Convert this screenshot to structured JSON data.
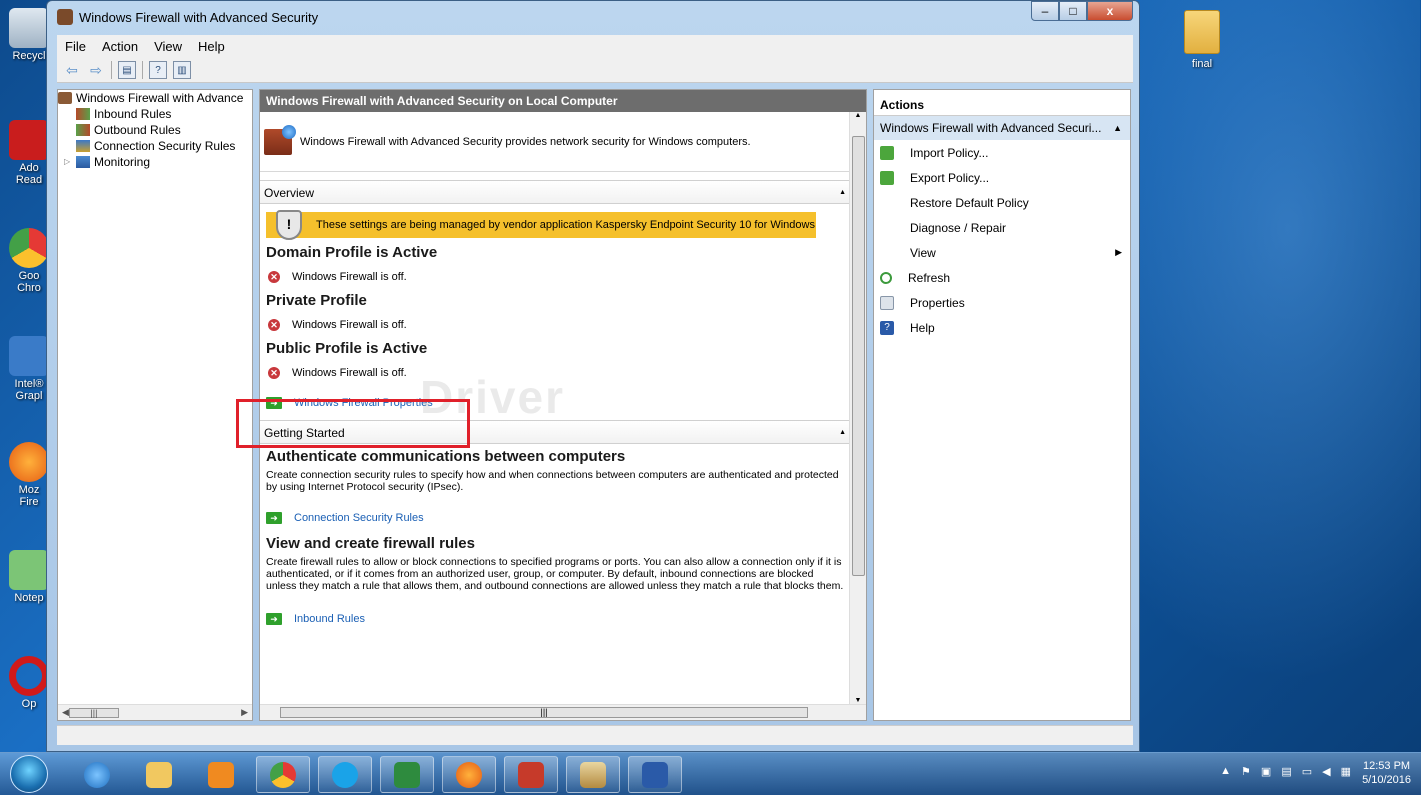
{
  "window": {
    "title": "Windows Firewall with Advanced Security",
    "controls": {
      "minimize": "–",
      "maximize": "□",
      "close": "x"
    }
  },
  "menubar": [
    "File",
    "Action",
    "View",
    "Help"
  ],
  "tree": {
    "root": "Windows Firewall with Advance",
    "items": [
      "Inbound Rules",
      "Outbound Rules",
      "Connection Security Rules",
      "Monitoring"
    ]
  },
  "center": {
    "header": "Windows Firewall with Advanced Security on Local Computer",
    "description": "Windows Firewall with Advanced Security provides network security for Windows computers.",
    "overview_label": "Overview",
    "banner": "These settings are being managed by vendor application Kaspersky Endpoint Security 10 for Windows",
    "profiles": [
      {
        "title": "Domain Profile is Active",
        "status": "Windows Firewall is off."
      },
      {
        "title": "Private Profile",
        "status": "Windows Firewall is off."
      },
      {
        "title": "Public Profile is Active",
        "status": "Windows Firewall is off."
      }
    ],
    "properties_link": "Windows Firewall Properties",
    "getting_started_label": "Getting Started",
    "authenticate": {
      "title": "Authenticate communications between computers",
      "text": "Create connection security rules to specify how and when connections between computers are authenticated and protected by using Internet Protocol security (IPsec).",
      "link": "Connection Security Rules"
    },
    "firewall_rules": {
      "title": "View and create firewall rules",
      "text": "Create firewall rules to allow or block connections to specified programs or ports. You can also allow a connection only if it is authenticated, or if it comes from an authorized user, group, or computer. By default, inbound connections are blocked unless they match a rule that allows them, and outbound connections are allowed unless they match a rule that blocks them.",
      "link": "Inbound Rules"
    },
    "watermark": "Driver"
  },
  "actions": {
    "header": "Actions",
    "subheader": "Windows Firewall with Advanced Securi...",
    "items": [
      {
        "label": "Import Policy...",
        "icon": "import-icon"
      },
      {
        "label": "Export Policy...",
        "icon": "export-icon"
      },
      {
        "label": "Restore Default Policy",
        "icon": ""
      },
      {
        "label": "Diagnose / Repair",
        "icon": ""
      },
      {
        "label": "View",
        "icon": ""
      },
      {
        "label": "Refresh",
        "icon": "refresh-icon"
      },
      {
        "label": "Properties",
        "icon": "properties-icon"
      },
      {
        "label": "Help",
        "icon": "help-icon"
      }
    ]
  },
  "desktop": {
    "icons": [
      "Recycl",
      "Ado\nRead",
      "Goo\nChro",
      "Intel®\nGrapl",
      "Moz\nFire",
      "Notep",
      "Op"
    ],
    "folder": "final"
  },
  "taskbar": {
    "time": "12:53 PM",
    "date": "5/10/2016"
  },
  "colors": {
    "accent_link": "#1a5fb4",
    "banner": "#f5c02c",
    "highlight_box": "#e0202a"
  }
}
